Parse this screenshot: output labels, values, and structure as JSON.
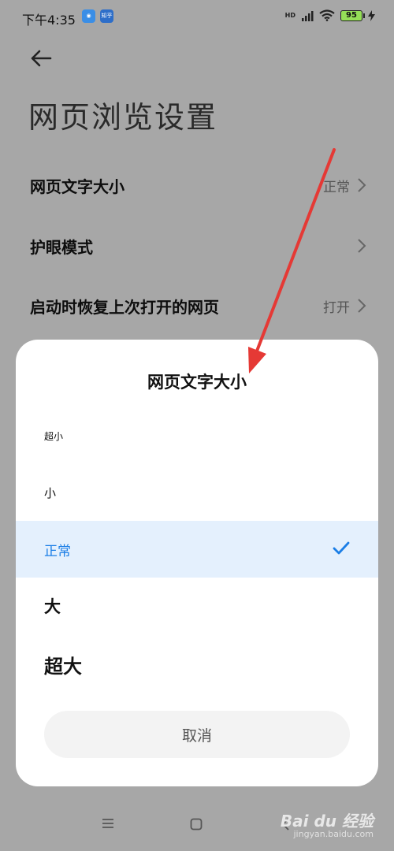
{
  "status_bar": {
    "time": "下午4:35",
    "app_icon_label": "知乎",
    "network": "HD",
    "battery": "95"
  },
  "page": {
    "title": "网页浏览设置",
    "rows": [
      {
        "label": "网页文字大小",
        "value": "正常"
      },
      {
        "label": "护眼模式",
        "value": ""
      },
      {
        "label": "启动时恢复上次打开的网页",
        "value": "打开"
      }
    ]
  },
  "dialog": {
    "title": "网页文字大小",
    "options": [
      {
        "label": "超小",
        "selected": false
      },
      {
        "label": "小",
        "selected": false
      },
      {
        "label": "正常",
        "selected": true
      },
      {
        "label": "大",
        "selected": false
      },
      {
        "label": "超大",
        "selected": false
      }
    ],
    "cancel_label": "取消"
  },
  "watermark": {
    "brand": "Bai du 经验",
    "url": "jingyan.baidu.com"
  },
  "colors": {
    "accent": "#1b7ee6",
    "selected_bg": "#e4f0fd",
    "annotation_arrow": "#e53935",
    "battery_green": "#95df58"
  },
  "icons": [
    "back-arrow-icon",
    "chevron-right-icon",
    "check-icon",
    "menu-icon",
    "home-icon",
    "back-icon",
    "wifi-icon",
    "signal-icon"
  ]
}
